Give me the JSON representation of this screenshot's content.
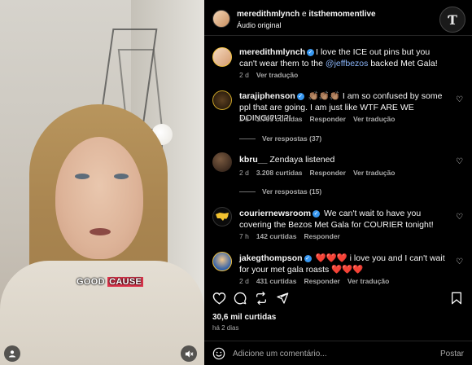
{
  "video": {
    "caption_a": "GOOD",
    "caption_b": "CAUSE"
  },
  "header": {
    "user1": "meredithmlynch",
    "joiner": " e ",
    "user2": "itsthemomentlive",
    "audio": "Áudio original"
  },
  "comments": [
    {
      "user": "meredithmlynch",
      "verified": true,
      "text_before": "I love the ICE out pins but you can't wear them to the ",
      "mention": "@jeffbezos",
      "text_after": " backed Met Gala!",
      "time": "2 d",
      "translate": "Ver tradução"
    },
    {
      "user": "tarajiphenson",
      "verified": true,
      "text": "👏🏽👏🏽👏🏽 I am so confused by some ppl that are going. I am just like WTF ARE WE DOING!?!?!?!",
      "time": "2 d",
      "likes": "3.799 curtidas",
      "reply": "Responder",
      "translate": "Ver tradução",
      "replies": "Ver respostas (37)"
    },
    {
      "user": "kbru__",
      "verified": false,
      "text": "Zendaya listened",
      "time": "2 d",
      "likes": "3.208 curtidas",
      "reply": "Responder",
      "translate": "Ver tradução",
      "replies": "Ver respostas (15)"
    },
    {
      "user": "couriernewsroom",
      "verified": true,
      "text": "We can't wait to have you covering the Bezos Met Gala for COURIER tonight!",
      "time": "7 h",
      "likes": "142 curtidas",
      "reply": "Responder"
    },
    {
      "user": "jakegthompson",
      "verified": true,
      "text": "❤️❤️❤️ i love you and I can't wait for your met gala roasts ❤️❤️❤️",
      "time": "2 d",
      "likes": "431 curtidas",
      "reply": "Responder",
      "translate": "Ver tradução"
    }
  ],
  "post": {
    "likes": "30,6 mil curtidas",
    "ago": "há 2 dias"
  },
  "composer": {
    "placeholder": "Adicione um comentário...",
    "post": "Postar"
  },
  "colors": {
    "verified": "#3797f0",
    "caption_highlight": "#e0344c",
    "background": "#000000",
    "muted_text": "#a8a8a8"
  }
}
